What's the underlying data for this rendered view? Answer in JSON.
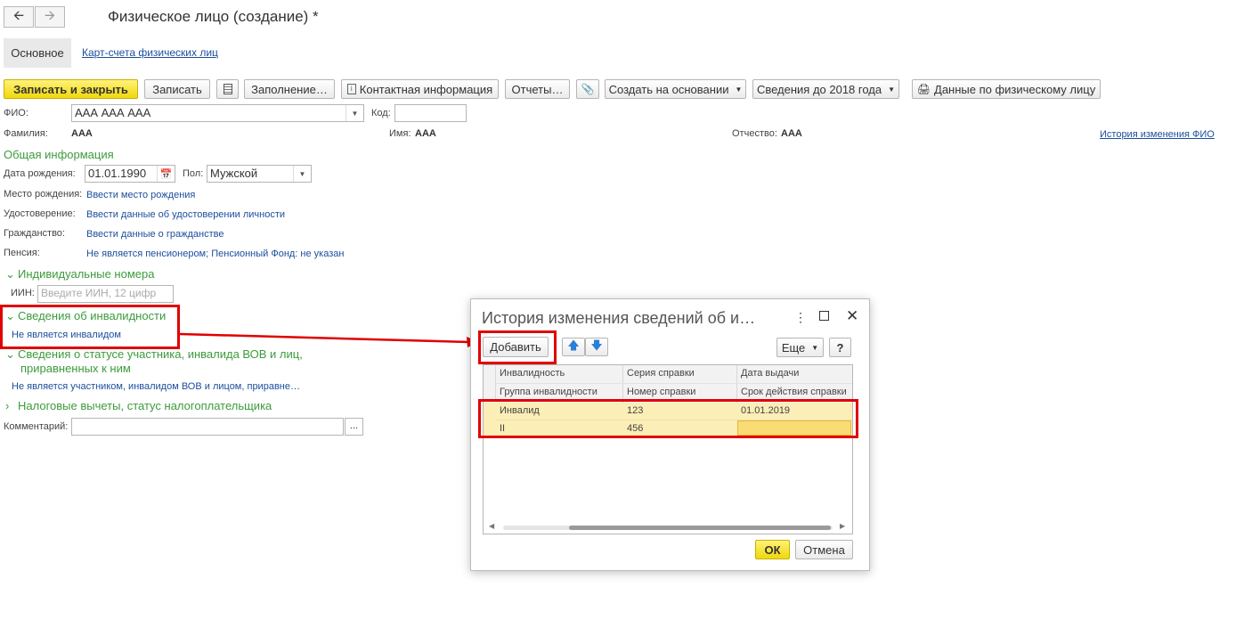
{
  "window": {
    "title": "Физическое лицо (создание) *",
    "nav": {
      "back_icon": "arrow-left-icon",
      "forward_icon": "arrow-right-icon"
    }
  },
  "tabs": {
    "main": "Основное",
    "cards": "Карт-счета физических лиц"
  },
  "toolbar": {
    "save_close": "Записать и закрыть",
    "save": "Записать",
    "fill": "Заполнение…",
    "contact": "Контактная информация",
    "reports": "Отчеты…",
    "create_based": "Создать на основании",
    "before2018": "Сведения до 2018 года",
    "person_data": "Данные по физическому лицу"
  },
  "form": {
    "fio_label": "ФИО:",
    "fio_value": "ААА ААА ААА",
    "code_label": "Код:",
    "surname_label": "Фамилия:",
    "surname_value": "ААА",
    "name_label": "Имя:",
    "name_value": "ААА",
    "patronymic_label": "Отчество:",
    "patronymic_value": "ААА",
    "history_link": "История изменения ФИО",
    "general_section": "Общая информация",
    "birthdate_label": "Дата рождения:",
    "birthdate_value": "01.01.1990",
    "gender_label": "Пол:",
    "gender_value": "Мужской",
    "birthplace_label": "Место рождения:",
    "birthplace_link": "Ввести место рождения",
    "id_label": "Удостоверение:",
    "id_link": "Ввести данные об удостоверении личности",
    "citizenship_label": "Гражданство:",
    "citizenship_link": "Ввести данные о гражданстве",
    "pension_label": "Пенсия:",
    "pension_link": "Не является пенсионером; Пенсионный Фонд: не указан",
    "individual_numbers_section": "Индивидуальные номера",
    "iin_label": "ИИН:",
    "iin_placeholder": "Введите ИИН, 12 цифр",
    "disability_section": "Сведения об инвалидности",
    "disability_link": "Не является инвалидом",
    "veteran_section_line1": "Сведения о статусе участника, инвалида ВОВ и лиц,",
    "veteran_section_line2": "приравненных к ним",
    "veteran_link": "Не является участником, инвалидом ВОВ и лицом, приравне…",
    "tax_section": "Налоговые вычеты, статус налогоплательщика",
    "comment_label": "Комментарий:",
    "comment_button": "..."
  },
  "dialog": {
    "title": "История изменения сведений об и…",
    "add_button": "Добавить",
    "more_button": "Еще",
    "help_button": "?",
    "columns": {
      "col1_top": "Инвалидность",
      "col1_bottom": "Группа инвалидности",
      "col2_top": "Серия справки",
      "col2_bottom": "Номер справки",
      "col3_top": "Дата выдачи",
      "col3_bottom": "Срок действия справки"
    },
    "rows": [
      {
        "disability": "Инвалид",
        "series": "123",
        "issue_date": "01.01.2019"
      },
      {
        "group": "II",
        "number": "456",
        "validity": ""
      }
    ],
    "ok_button": "ОК",
    "cancel_button": "Отмена"
  },
  "colors": {
    "primary_button": "#f0d80a",
    "section_green": "#3c9b3c",
    "link_blue": "#1b4e9c",
    "highlight_red": "#e00000",
    "selected_row": "#fbeeb6"
  }
}
